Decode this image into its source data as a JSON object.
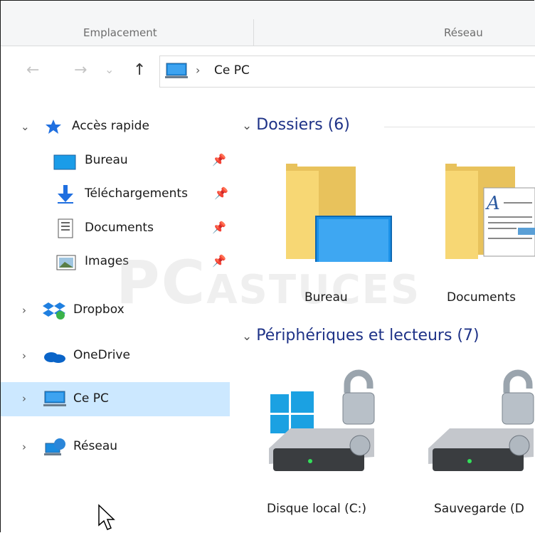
{
  "ribbon": {
    "tabs": [
      "Emplacement",
      "Réseau"
    ]
  },
  "address": {
    "crumb_separator": "›",
    "location": "Ce PC"
  },
  "nav": {
    "back": "←",
    "forward": "→",
    "recent": "⌄",
    "up": "↑"
  },
  "sidebar": {
    "quick_access": {
      "label": "Accès rapide",
      "expanded": true
    },
    "pinned": [
      {
        "label": "Bureau",
        "icon": "desktop-icon"
      },
      {
        "label": "Téléchargements",
        "icon": "download-icon"
      },
      {
        "label": "Documents",
        "icon": "document-icon"
      },
      {
        "label": "Images",
        "icon": "image-icon"
      }
    ],
    "roots": [
      {
        "label": "Dropbox",
        "icon": "dropbox-icon"
      },
      {
        "label": "OneDrive",
        "icon": "onedrive-icon"
      },
      {
        "label": "Ce PC",
        "icon": "computer-icon",
        "selected": true
      },
      {
        "label": "Réseau",
        "icon": "network-icon"
      }
    ]
  },
  "main": {
    "folders_group": "Dossiers (6)",
    "folders": [
      {
        "label": "Bureau"
      },
      {
        "label": "Documents"
      }
    ],
    "devices_group": "Périphériques et lecteurs (7)",
    "devices": [
      {
        "label": "Disque local (C:)"
      },
      {
        "label": "Sauvegarde (D"
      }
    ]
  },
  "watermark": {
    "big": "PC",
    "rest": "ASTUCES"
  },
  "colors": {
    "selection": "#cce8ff",
    "group_header": "#1e3287",
    "folder": "#f7d774"
  }
}
